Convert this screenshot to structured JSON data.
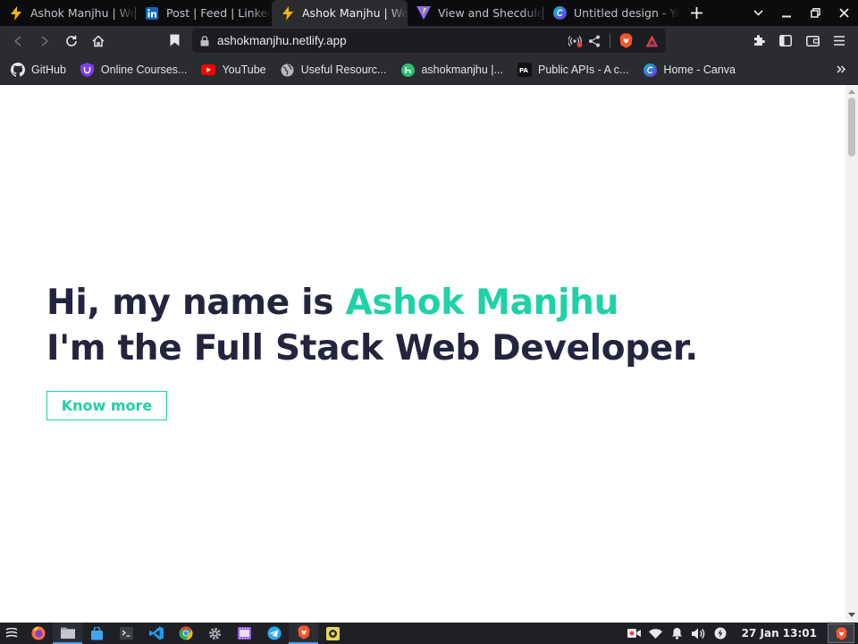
{
  "tabs": [
    {
      "title": "Ashok Manjhu | Web",
      "icon": "bolt-icon",
      "active": false
    },
    {
      "title": "Post | Feed | LinkedIn",
      "icon": "linkedin-icon",
      "active": false
    },
    {
      "title": "Ashok Manjhu | Web",
      "icon": "bolt-icon",
      "active": true
    },
    {
      "title": "View and Shecdule",
      "icon": "vite-icon",
      "active": false
    },
    {
      "title": "Untitled design - Yo",
      "icon": "canva-icon",
      "active": false
    }
  ],
  "address_bar": {
    "url": "ashokmanjhu.netlify.app"
  },
  "bookmarks": [
    {
      "label": "GitHub",
      "icon": "github-icon"
    },
    {
      "label": "Online Courses...",
      "icon": "shield-icon"
    },
    {
      "label": "YouTube",
      "icon": "youtube-icon"
    },
    {
      "label": "Useful Resourc...",
      "icon": "globe-icon"
    },
    {
      "label": "ashokmanjhu |...",
      "icon": "hashnode-icon"
    },
    {
      "label": "Public APIs - A c...",
      "icon": "publicapis-icon"
    },
    {
      "label": "Home - Canva",
      "icon": "canva-icon"
    }
  ],
  "hero": {
    "greeting": "Hi, my name is ",
    "name": "Ashok Manjhu",
    "role_line": "I'm the Full Stack Web Developer.",
    "button_label": "Know more"
  },
  "taskbar": {
    "clock": "27 Jan 13:01"
  },
  "colors": {
    "accent": "#1fd1a6",
    "heading": "#24243e"
  }
}
